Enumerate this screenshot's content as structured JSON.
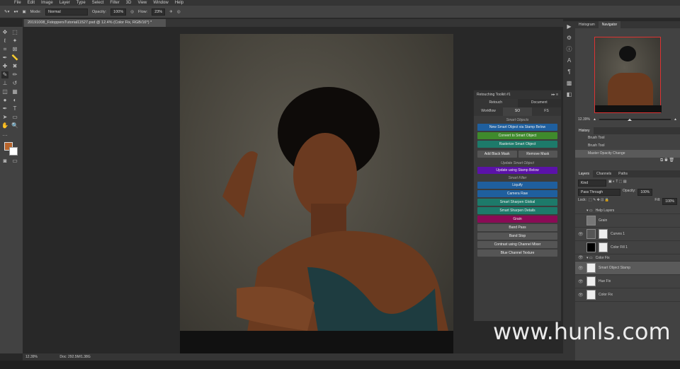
{
  "menu": [
    "File",
    "Edit",
    "Image",
    "Layer",
    "Type",
    "Select",
    "Filter",
    "3D",
    "View",
    "Window",
    "Help"
  ],
  "options": {
    "mode_label": "Mode:",
    "mode": "Normal",
    "opacity_label": "Opacity:",
    "opacity": "100%",
    "flow_label": "Flow:",
    "flow": "23%"
  },
  "document_tab": "20191008_FstoppersTutorial11527.psd @ 12.4% (Color Fix, RGB/16*) *",
  "status": {
    "zoom": "12.39%",
    "doc": "Doc: 292.5M/1.38G"
  },
  "navigator": {
    "tabs": [
      "Histogram",
      "Navigator"
    ],
    "zoom": "12.39%"
  },
  "history": {
    "title": "History",
    "items": [
      "Brush Tool",
      "Brush Tool",
      "Master Opacity Change"
    ]
  },
  "layers": {
    "tabs": [
      "Layers",
      "Channels",
      "Paths"
    ],
    "kind": "Kind",
    "blend": "Pass Through",
    "opacity_label": "Opacity:",
    "opacity": "100%",
    "lock_label": "Lock:",
    "fill_label": "Fill:",
    "fill": "100%",
    "items": [
      "Help Layers",
      "Grain",
      "Curves 1",
      "Color Fill 1",
      "Color Fix",
      "Smart Object Stamp",
      "Hue Fix",
      "Color Fix"
    ]
  },
  "toolkit": {
    "title": "Retouching Toolkit #1",
    "tabs1": [
      "Retouch",
      "Document"
    ],
    "tabs2": [
      "Workflow",
      "SO",
      "FS"
    ],
    "smart_objects_label": "Smart Objects",
    "new_so": "New Smart Object via Stamp Below",
    "convert": "Convert to Smart Object",
    "rasterize": "Rasterize Smart Object",
    "add_black": "Add Black Mask",
    "remove_mask": "Remove Mask",
    "update_label": "Update Smart Object",
    "update": "Update using Stamp Below",
    "filter_label": "Smart Filter",
    "liquify": "Liquify",
    "camera_raw": "Camera Raw",
    "sharpen_global": "Smart Sharpen Global",
    "sharpen_details": "Smart Sharpen Details",
    "grain": "Grain",
    "band_pass": "Band Pass",
    "band_stop": "Band Stop",
    "contrast": "Contrast using Channel Mixer",
    "blue_texture": "Blue Channel Texture"
  },
  "watermark": "www.hunls.com"
}
